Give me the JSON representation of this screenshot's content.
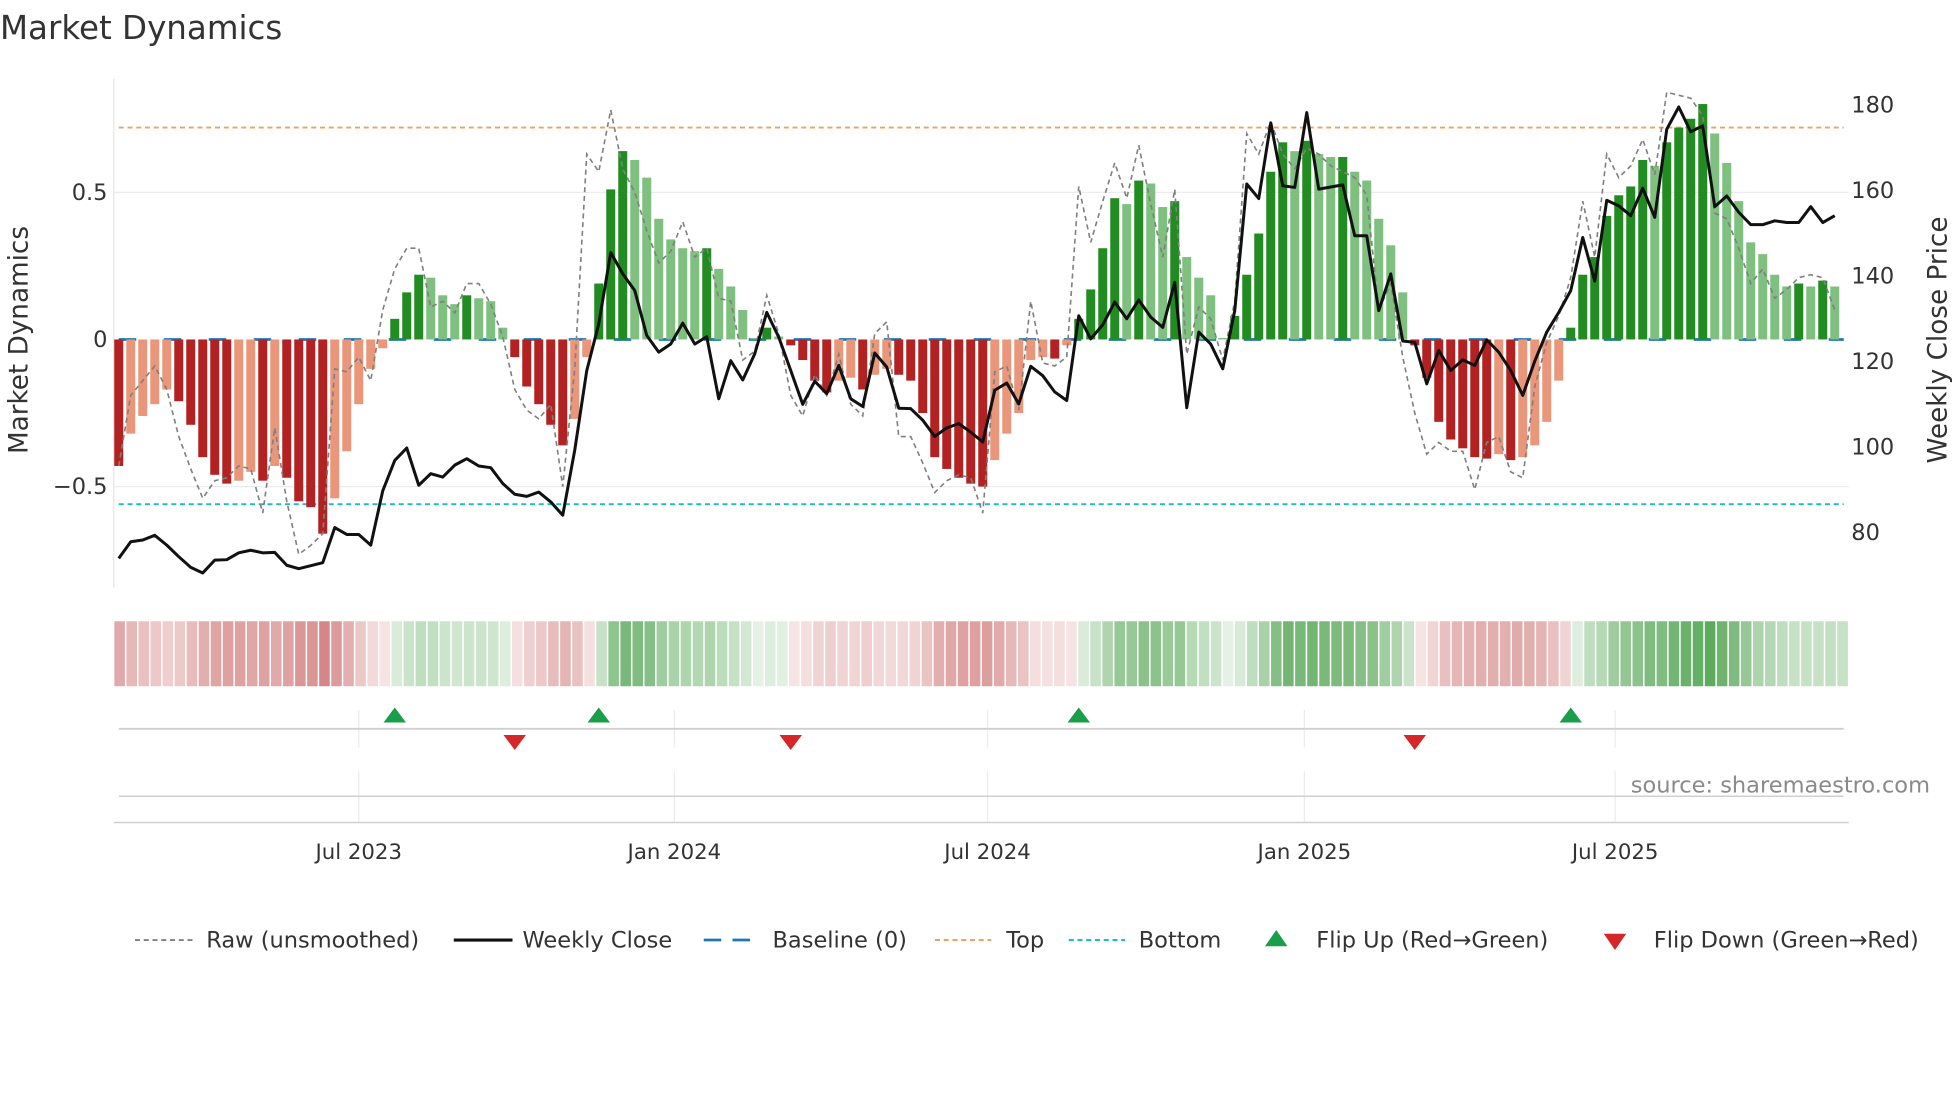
{
  "chart_data": {
    "type": "bar",
    "title": "Market Dynamics",
    "ylabel": "Market Dynamics",
    "y2label": "Weekly Close Price",
    "ylim": [
      -0.843,
      0.886
    ],
    "y2lim": [
      66.9,
      185.8
    ],
    "yticks": [
      {
        "value": 0.5,
        "label": "0.5"
      },
      {
        "value": 0,
        "label": "0"
      },
      {
        "value": -0.5,
        "label": "−0.5"
      }
    ],
    "y2ticks": [
      180,
      160,
      140,
      120,
      100,
      80
    ],
    "x_start": "2023-02-05",
    "x_freq": "weekly",
    "xticks": [
      {
        "week_index": 21,
        "label": "Jul 2023"
      },
      {
        "week_index": 47.3,
        "label": "Jan 2024"
      },
      {
        "week_index": 73.4,
        "label": "Jul 2024"
      },
      {
        "week_index": 99.8,
        "label": "Jan 2025"
      },
      {
        "week_index": 125.7,
        "label": "Jul 2025"
      }
    ],
    "top_level": 0.72,
    "bottom_level": -0.56,
    "baseline": 0,
    "dynamics": [
      -0.43,
      -0.32,
      -0.26,
      -0.22,
      -0.17,
      -0.21,
      -0.29,
      -0.4,
      -0.46,
      -0.49,
      -0.48,
      -0.45,
      -0.48,
      -0.43,
      -0.47,
      -0.55,
      -0.57,
      -0.66,
      -0.54,
      -0.38,
      -0.22,
      -0.1,
      -0.03,
      0.07,
      0.16,
      0.22,
      0.21,
      0.15,
      0.12,
      0.15,
      0.14,
      0.13,
      0.04,
      -0.06,
      -0.16,
      -0.22,
      -0.29,
      -0.36,
      -0.27,
      -0.06,
      0.19,
      0.51,
      0.64,
      0.61,
      0.55,
      0.41,
      0.34,
      0.31,
      0.3,
      0.31,
      0.24,
      0.18,
      0.1,
      0.005,
      0.04,
      0.01,
      -0.02,
      -0.07,
      -0.14,
      -0.18,
      -0.14,
      -0.13,
      -0.17,
      -0.12,
      -0.1,
      -0.12,
      -0.14,
      -0.25,
      -0.4,
      -0.44,
      -0.47,
      -0.49,
      -0.5,
      -0.41,
      -0.32,
      -0.25,
      -0.07,
      -0.06,
      -0.065,
      -0.02,
      0.07,
      0.17,
      0.31,
      0.48,
      0.46,
      0.54,
      0.53,
      0.45,
      0.47,
      0.28,
      0.21,
      0.15,
      0.005,
      0.08,
      0.22,
      0.36,
      0.57,
      0.67,
      0.64,
      0.675,
      0.63,
      0.62,
      0.62,
      0.57,
      0.54,
      0.41,
      0.32,
      0.16,
      -0.02,
      -0.13,
      -0.28,
      -0.34,
      -0.37,
      -0.4,
      -0.405,
      -0.39,
      -0.41,
      -0.4,
      -0.36,
      -0.28,
      -0.14,
      0.04,
      0.22,
      0.28,
      0.42,
      0.49,
      0.52,
      0.61,
      0.59,
      0.67,
      0.72,
      0.75,
      0.8,
      0.7,
      0.6,
      0.47,
      0.33,
      0.29,
      0.22,
      0.18,
      0.19,
      0.18,
      0.2,
      0.18
    ],
    "raw": [
      -0.43,
      -0.19,
      -0.14,
      -0.09,
      -0.17,
      -0.33,
      -0.44,
      -0.54,
      -0.48,
      -0.47,
      -0.43,
      -0.44,
      -0.59,
      -0.3,
      -0.55,
      -0.73,
      -0.7,
      -0.66,
      -0.1,
      -0.11,
      -0.06,
      -0.14,
      0.1,
      0.24,
      0.31,
      0.31,
      0.11,
      0.13,
      0.09,
      0.19,
      0.19,
      0.12,
      0.01,
      -0.17,
      -0.24,
      -0.27,
      -0.22,
      -0.5,
      -0.1,
      0.63,
      0.57,
      0.78,
      0.58,
      0.5,
      0.37,
      0.26,
      0.3,
      0.4,
      0.28,
      0.31,
      0.14,
      0.13,
      -0.07,
      -0.04,
      0.15,
      0.02,
      -0.19,
      -0.26,
      -0.12,
      -0.19,
      -0.05,
      -0.22,
      -0.26,
      0.02,
      0.06,
      -0.33,
      -0.33,
      -0.42,
      -0.52,
      -0.48,
      -0.46,
      -0.47,
      -0.59,
      -0.11,
      -0.09,
      -0.24,
      0.13,
      -0.08,
      -0.09,
      -0.06,
      0.52,
      0.33,
      0.47,
      0.6,
      0.48,
      0.66,
      0.46,
      0.28,
      0.51,
      -0.05,
      0.11,
      0.07,
      -0.07,
      0.13,
      0.7,
      0.63,
      0.74,
      0.63,
      0.58,
      0.65,
      0.63,
      0.59,
      0.57,
      0.55,
      0.49,
      0.1,
      0.19,
      -0.06,
      -0.25,
      -0.39,
      -0.35,
      -0.38,
      -0.38,
      -0.51,
      -0.35,
      -0.33,
      -0.45,
      -0.47,
      -0.16,
      -0.01,
      0.08,
      0.21,
      0.47,
      0.28,
      0.63,
      0.55,
      0.59,
      0.68,
      0.56,
      0.84,
      0.83,
      0.82,
      0.76,
      0.43,
      0.41,
      0.31,
      0.19,
      0.24,
      0.14,
      0.17,
      0.21,
      0.22,
      0.21,
      0.1
    ],
    "weekly_close": [
      73.7,
      77.6,
      78.0,
      79.1,
      76.8,
      74.1,
      71.6,
      70.3,
      73.3,
      73.4,
      75.0,
      75.6,
      75.0,
      75.1,
      72.1,
      71.3,
      72.0,
      72.7,
      80.9,
      79.3,
      79.3,
      76.8,
      89.5,
      96.6,
      99.5,
      90.8,
      93.5,
      92.7,
      95.5,
      97.0,
      95.3,
      94.9,
      91.2,
      88.7,
      88.2,
      89.2,
      86.9,
      83.8,
      99.0,
      117.6,
      128.5,
      145.2,
      140.2,
      136.3,
      125.8,
      121.9,
      123.8,
      128.7,
      123.8,
      125.5,
      111.0,
      119.9,
      115.4,
      121.5,
      131.2,
      125.4,
      117.6,
      109.7,
      115.1,
      112.2,
      118.8,
      111.0,
      109.2,
      121.7,
      118.4,
      108.8,
      108.7,
      106.0,
      102.2,
      104.2,
      105.2,
      103.2,
      100.9,
      113.0,
      114.7,
      109.8,
      118.6,
      116.4,
      112.6,
      110.6,
      130.4,
      125.0,
      128.3,
      133.6,
      129.7,
      134.1,
      130.1,
      127.7,
      138.2,
      108.9,
      126.6,
      123.8,
      118.0,
      131.6,
      161.2,
      157.8,
      175.5,
      160.8,
      160.4,
      177.9,
      160.0,
      160.5,
      161.0,
      149.1,
      149.1,
      131.6,
      140.2,
      124.5,
      124.2,
      114.5,
      122.3,
      117.6,
      120.1,
      118.8,
      124.8,
      121.9,
      117.6,
      111.8,
      119.8,
      126.6,
      131.2,
      136.3,
      148.7,
      138.5,
      157.4,
      156.1,
      153.8,
      160.2,
      153.4,
      174.0,
      179.2,
      173.4,
      174.8,
      155.9,
      158.4,
      154.6,
      151.7,
      151.7,
      152.6,
      152.2,
      152.2,
      155.9,
      152.2,
      153.8
    ],
    "legend": [
      {
        "label": "Raw (unsmoothed)",
        "symbol": "dashed-line",
        "color": "#808080"
      },
      {
        "label": "Weekly Close",
        "symbol": "line",
        "color": "#111111"
      },
      {
        "label": "Baseline (0)",
        "symbol": "dashed-line",
        "color": "#1f77b4"
      },
      {
        "label": "Top",
        "symbol": "dotted-line",
        "color": "#f0a060"
      },
      {
        "label": "Bottom",
        "symbol": "dotted-line",
        "color": "#17becf"
      },
      {
        "label": "Flip Up (Red→Green)",
        "symbol": "triangle-up",
        "color": "#1a9e4a"
      },
      {
        "label": "Flip Down (Green→Red)",
        "symbol": "triangle-down",
        "color": "#d62728"
      }
    ],
    "legend_position": "bottom",
    "source": "source: sharemaestro.com"
  },
  "colors": {
    "pos_strong": "#228b22",
    "pos_weak": "#7fbf7f",
    "neg_strong": "#b22222",
    "neg_weak": "#e9967a",
    "flip_up": "#1a9e4a",
    "flip_down": "#d62728"
  }
}
